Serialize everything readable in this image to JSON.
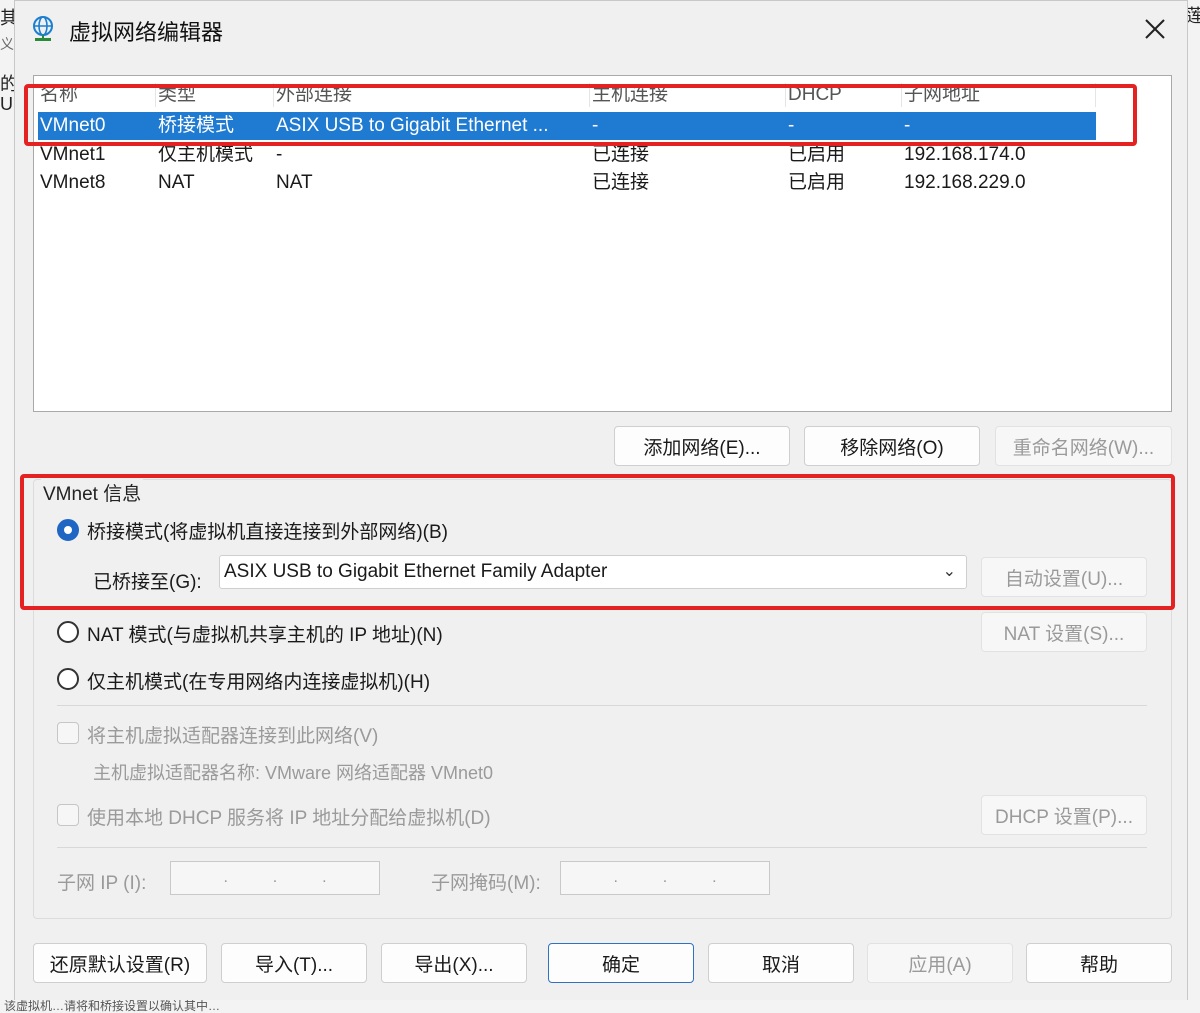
{
  "background": {
    "left_fragments": [
      "其",
      "义",
      "的",
      "U"
    ],
    "right_fragment": "莲",
    "bottom_fragment": "该虚拟机…请将和桥接设置以确认其中…"
  },
  "dialog": {
    "title": "虚拟网络编辑器",
    "close_symbol": "✕"
  },
  "network_table": {
    "columns": [
      "名称",
      "类型",
      "外部连接",
      "主机连接",
      "DHCP",
      "子网地址"
    ],
    "rows": [
      {
        "name": "VMnet0",
        "type": "桥接模式",
        "external": "ASIX USB to Gigabit Ethernet ...",
        "host": "-",
        "dhcp": "-",
        "subnet": "-",
        "selected": true
      },
      {
        "name": "VMnet1",
        "type": "仅主机模式",
        "external": "-",
        "host": "已连接",
        "dhcp": "已启用",
        "subnet": "192.168.174.0",
        "selected": false
      },
      {
        "name": "VMnet8",
        "type": "NAT",
        "external": "NAT",
        "host": "已连接",
        "dhcp": "已启用",
        "subnet": "192.168.229.0",
        "selected": false
      }
    ]
  },
  "list_buttons": {
    "add": "添加网络(E)...",
    "remove": "移除网络(O)",
    "rename": "重命名网络(W)..."
  },
  "vmnet_info": {
    "title": "VMnet 信息",
    "bridged_mode": "桥接模式(将虚拟机直接连接到外部网络)(B)",
    "bridged_to_label": "已桥接至(G):",
    "bridged_to_value": "ASIX USB to Gigabit Ethernet Family Adapter",
    "auto_settings": "自动设置(U)...",
    "nat_mode": "NAT 模式(与虚拟机共享主机的 IP 地址)(N)",
    "nat_settings": "NAT 设置(S)...",
    "host_only_mode": "仅主机模式(在专用网络内连接虚拟机)(H)",
    "connect_host_adapter": "将主机虚拟适配器连接到此网络(V)",
    "host_adapter_name": "主机虚拟适配器名称: VMware 网络适配器 VMnet0",
    "use_dhcp": "使用本地 DHCP 服务将 IP 地址分配给虚拟机(D)",
    "dhcp_settings": "DHCP 设置(P)...",
    "subnet_ip_label": "子网 IP (I):",
    "subnet_mask_label": "子网掩码(M):",
    "ip_dots": ".",
    "selected_mode": "bridged"
  },
  "footer_buttons": {
    "restore": "还原默认设置(R)",
    "import": "导入(T)...",
    "export": "导出(X)...",
    "ok": "确定",
    "cancel": "取消",
    "apply": "应用(A)",
    "help": "帮助"
  },
  "colors": {
    "selection": "#1f7ad1",
    "highlight_box": "#e42222",
    "radio_accent": "#1f66c4",
    "dialog_bg": "#f0f0f0"
  },
  "icons": {
    "title": "globe-network-icon",
    "dropdown": "chevron-down-icon",
    "close": "close-icon"
  }
}
